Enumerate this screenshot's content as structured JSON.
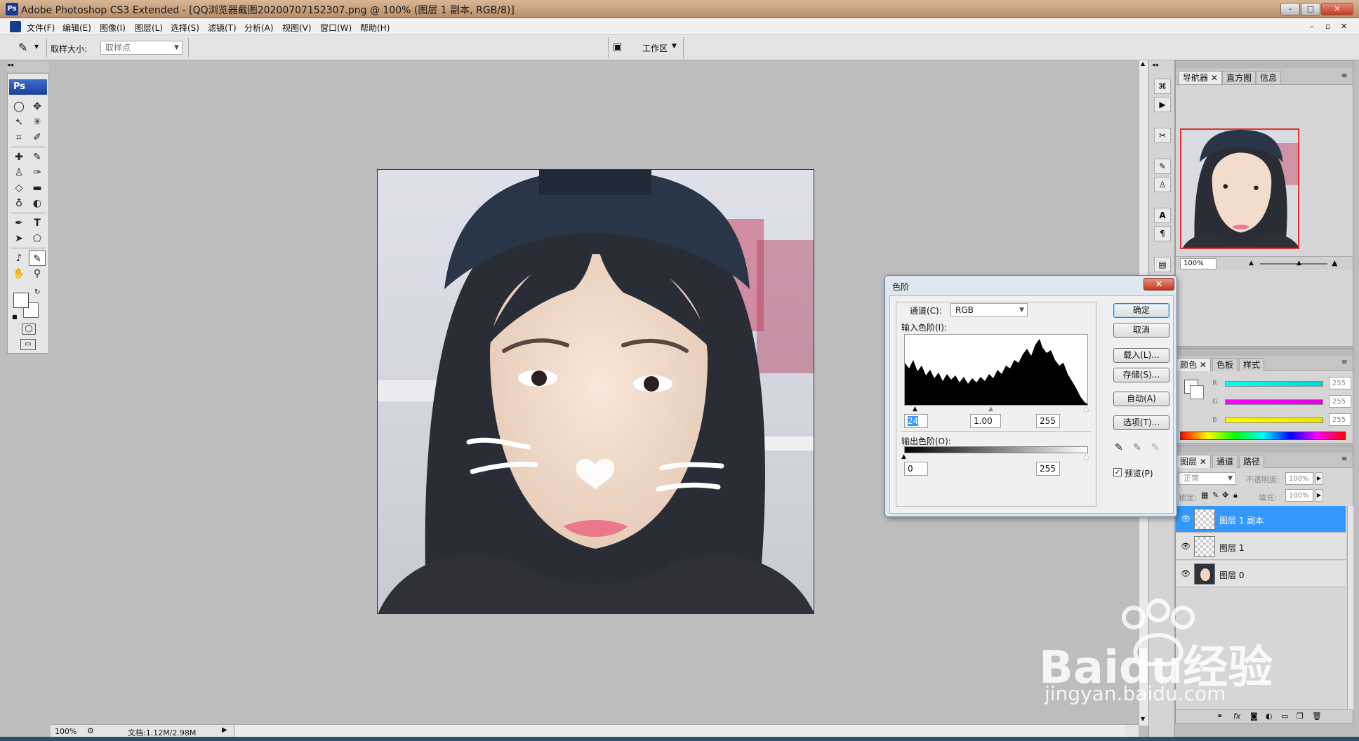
{
  "window": {
    "app_icon": "Ps",
    "title": "Adobe Photoshop CS3 Extended - [QQ浏览器截图20200707152307.png @ 100% (图层 1 副本, RGB/8)]",
    "minimize": "–",
    "maximize": "□",
    "close": "✕"
  },
  "menu": {
    "items": [
      "文件(F)",
      "编辑(E)",
      "图像(I)",
      "图层(L)",
      "选择(S)",
      "滤镜(T)",
      "分析(A)",
      "视图(V)",
      "窗口(W)",
      "帮助(H)"
    ]
  },
  "options_bar": {
    "sample_size_label": "取样大小:",
    "sample_size_value": "取样点",
    "workspace_label": "工作区"
  },
  "toolbox": {
    "logo": "Ps"
  },
  "status_bar": {
    "zoom": "100%",
    "doc_info": "文档:1.12M/2.98M"
  },
  "navigator_panel": {
    "tabs": [
      "导航器",
      "直方图",
      "信息"
    ],
    "zoom_value": "100%"
  },
  "color_panel": {
    "tabs": [
      "颜色",
      "色板",
      "样式"
    ],
    "channels": [
      {
        "label": "R",
        "value": "255",
        "color": "#00d4d4"
      },
      {
        "label": "G",
        "value": "255",
        "color": "#e600e6"
      },
      {
        "label": "B",
        "value": "255",
        "color": "#e6e600"
      }
    ]
  },
  "layers_panel": {
    "tabs": [
      "图层",
      "通道",
      "路径"
    ],
    "blend_mode": "正常",
    "opacity_label": "不透明度:",
    "opacity_value": "100%",
    "lock_label": "锁定:",
    "fill_label": "填充:",
    "fill_value": "100%",
    "layers": [
      {
        "name": "图层 1 副本",
        "selected": true
      },
      {
        "name": "图层 1",
        "selected": false
      },
      {
        "name": "图层 0",
        "selected": false
      }
    ]
  },
  "levels_dialog": {
    "title": "色阶",
    "close": "✕",
    "channel_label": "通道(C):",
    "channel_value": "RGB",
    "input_levels_label": "输入色阶(I):",
    "input_black": "24",
    "input_gamma": "1.00",
    "input_white": "255",
    "output_levels_label": "输出色阶(O):",
    "output_black": "0",
    "output_white": "255",
    "buttons": {
      "ok": "确定",
      "cancel": "取消",
      "load": "载入(L)...",
      "save": "存储(S)...",
      "auto": "自动(A)",
      "options": "选项(T)..."
    },
    "preview_label": "预览(P)",
    "preview_checked": true
  },
  "watermark": {
    "brand": "Baidu经验",
    "url": "jingyan.baidu.com"
  }
}
